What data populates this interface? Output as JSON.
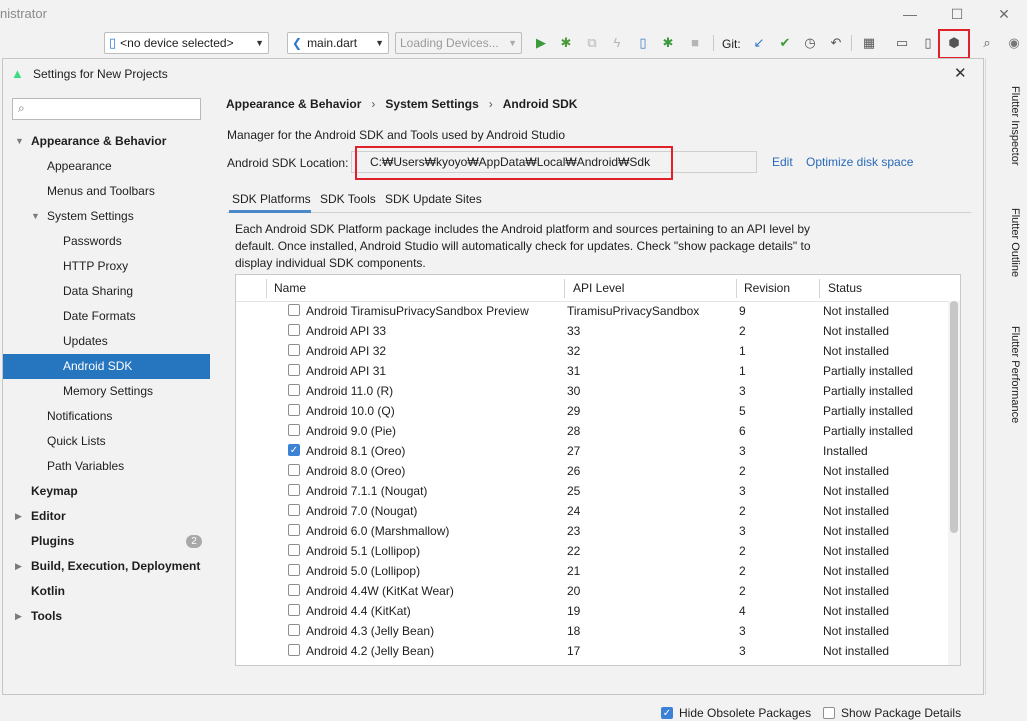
{
  "window": {
    "title": "nistrator"
  },
  "toolbar": {
    "device_selector": "<no device selected>",
    "run_config": "main.dart",
    "loading_devices": "Loading Devices...",
    "git_label": "Git:"
  },
  "right_strip": {
    "tabs": [
      "Flutter Inspector",
      "Flutter Outline",
      "Flutter Performance"
    ]
  },
  "dialog": {
    "title": "Settings for New Projects",
    "search_placeholder": "",
    "sidebar": [
      {
        "label": "Appearance & Behavior",
        "level": 0,
        "bold": true,
        "expanded": true
      },
      {
        "label": "Appearance",
        "level": 1
      },
      {
        "label": "Menus and Toolbars",
        "level": 1
      },
      {
        "label": "System Settings",
        "level": 1,
        "expanded": true
      },
      {
        "label": "Passwords",
        "level": 2
      },
      {
        "label": "HTTP Proxy",
        "level": 2
      },
      {
        "label": "Data Sharing",
        "level": 2
      },
      {
        "label": "Date Formats",
        "level": 2
      },
      {
        "label": "Updates",
        "level": 2
      },
      {
        "label": "Android SDK",
        "level": 2,
        "selected": true
      },
      {
        "label": "Memory Settings",
        "level": 2
      },
      {
        "label": "Notifications",
        "level": 1
      },
      {
        "label": "Quick Lists",
        "level": 1
      },
      {
        "label": "Path Variables",
        "level": 1
      },
      {
        "label": "Keymap",
        "level": 0,
        "bold": true
      },
      {
        "label": "Editor",
        "level": 0,
        "bold": true,
        "collapsed": true
      },
      {
        "label": "Plugins",
        "level": 0,
        "bold": true,
        "badge": "2"
      },
      {
        "label": "Build, Execution, Deployment",
        "level": 0,
        "bold": true,
        "collapsed": true
      },
      {
        "label": "Kotlin",
        "level": 0,
        "bold": true
      },
      {
        "label": "Tools",
        "level": 0,
        "bold": true,
        "collapsed": true
      }
    ],
    "breadcrumb": [
      "Appearance & Behavior",
      "System Settings",
      "Android SDK"
    ],
    "manager_text": "Manager for the Android SDK and Tools used by Android Studio",
    "sdk_location_label": "Android SDK Location:",
    "sdk_location_value": "C:₩Users₩kyoyo₩AppData₩Local₩Android₩Sdk",
    "edit_link": "Edit",
    "optimize_link": "Optimize disk space",
    "tabs": [
      "SDK Platforms",
      "SDK Tools",
      "SDK Update Sites"
    ],
    "active_tab": "SDK Platforms",
    "description": [
      "Each Android SDK Platform package includes the Android platform and sources pertaining to an API level by",
      "default. Once installed, Android Studio will automatically check for updates. Check \"show package details\" to",
      "display individual SDK components."
    ],
    "table": {
      "headers": [
        "Name",
        "API Level",
        "Revision",
        "Status"
      ],
      "rows": [
        {
          "checked": false,
          "name": "Android TiramisuPrivacySandbox Preview",
          "api": "TiramisuPrivacySandbox",
          "rev": "9",
          "status": "Not installed"
        },
        {
          "checked": false,
          "name": "Android API 33",
          "api": "33",
          "rev": "2",
          "status": "Not installed"
        },
        {
          "checked": false,
          "name": "Android API 32",
          "api": "32",
          "rev": "1",
          "status": "Not installed"
        },
        {
          "checked": false,
          "name": "Android API 31",
          "api": "31",
          "rev": "1",
          "status": "Partially installed"
        },
        {
          "checked": false,
          "name": "Android 11.0 (R)",
          "api": "30",
          "rev": "3",
          "status": "Partially installed"
        },
        {
          "checked": false,
          "name": "Android 10.0 (Q)",
          "api": "29",
          "rev": "5",
          "status": "Partially installed"
        },
        {
          "checked": false,
          "name": "Android 9.0 (Pie)",
          "api": "28",
          "rev": "6",
          "status": "Partially installed"
        },
        {
          "checked": true,
          "name": "Android 8.1 (Oreo)",
          "api": "27",
          "rev": "3",
          "status": "Installed"
        },
        {
          "checked": false,
          "name": "Android 8.0 (Oreo)",
          "api": "26",
          "rev": "2",
          "status": "Not installed"
        },
        {
          "checked": false,
          "name": "Android 7.1.1 (Nougat)",
          "api": "25",
          "rev": "3",
          "status": "Not installed"
        },
        {
          "checked": false,
          "name": "Android 7.0 (Nougat)",
          "api": "24",
          "rev": "2",
          "status": "Not installed"
        },
        {
          "checked": false,
          "name": "Android 6.0 (Marshmallow)",
          "api": "23",
          "rev": "3",
          "status": "Not installed"
        },
        {
          "checked": false,
          "name": "Android 5.1 (Lollipop)",
          "api": "22",
          "rev": "2",
          "status": "Not installed"
        },
        {
          "checked": false,
          "name": "Android 5.0 (Lollipop)",
          "api": "21",
          "rev": "2",
          "status": "Not installed"
        },
        {
          "checked": false,
          "name": "Android 4.4W (KitKat Wear)",
          "api": "20",
          "rev": "2",
          "status": "Not installed"
        },
        {
          "checked": false,
          "name": "Android 4.4 (KitKat)",
          "api": "19",
          "rev": "4",
          "status": "Not installed"
        },
        {
          "checked": false,
          "name": "Android 4.3 (Jelly Bean)",
          "api": "18",
          "rev": "3",
          "status": "Not installed"
        },
        {
          "checked": false,
          "name": "Android 4.2 (Jelly Bean)",
          "api": "17",
          "rev": "3",
          "status": "Not installed"
        }
      ]
    },
    "hide_obsolete_label": "Hide Obsolete Packages",
    "hide_obsolete_checked": true,
    "show_details_label": "Show Package Details",
    "show_details_checked": false
  },
  "colors": {
    "selection": "#2675bf",
    "link": "#2a6ab8",
    "highlight_box": "#e0202a",
    "checkbox_on": "#3b82d6"
  }
}
